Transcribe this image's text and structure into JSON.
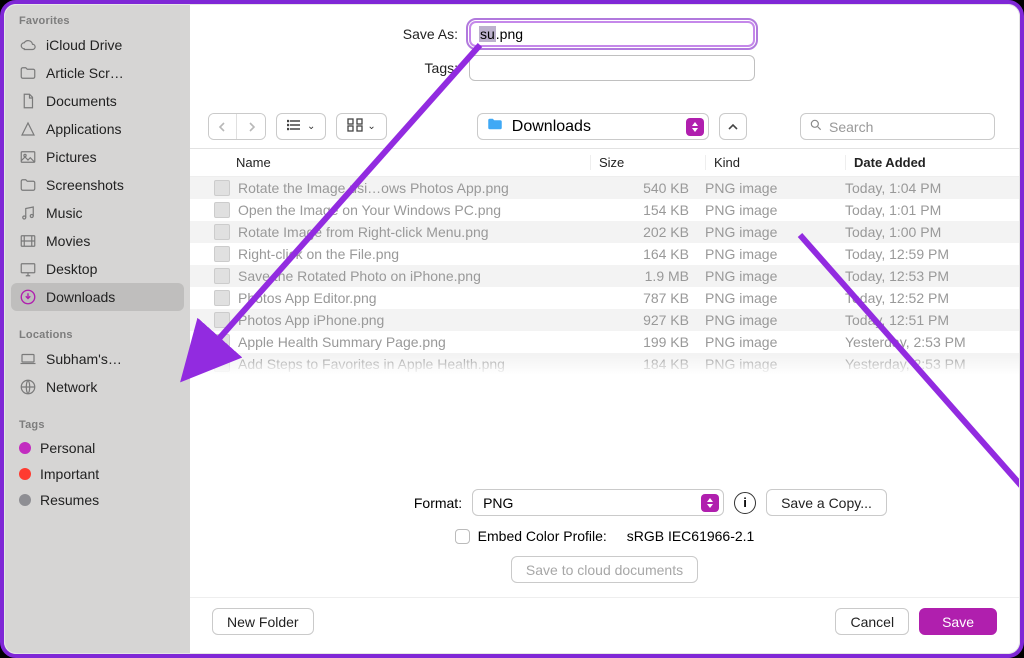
{
  "sidebar": {
    "favorites_header": "Favorites",
    "items": [
      {
        "label": "iCloud Drive"
      },
      {
        "label": "Article Scr…"
      },
      {
        "label": "Documents"
      },
      {
        "label": "Applications"
      },
      {
        "label": "Pictures"
      },
      {
        "label": "Screenshots"
      },
      {
        "label": "Music"
      },
      {
        "label": "Movies"
      },
      {
        "label": "Desktop"
      },
      {
        "label": "Downloads"
      }
    ],
    "locations_header": "Locations",
    "locations": [
      {
        "label": "Subham's…"
      },
      {
        "label": "Network"
      }
    ],
    "tags_header": "Tags",
    "tags": [
      {
        "label": "Personal",
        "color": "#c22cc0"
      },
      {
        "label": "Important",
        "color": "#ff3b30"
      },
      {
        "label": "Resumes",
        "color": "#8e8e93"
      }
    ]
  },
  "fields": {
    "saveas_label": "Save As:",
    "filename_selected": "su",
    "filename_rest": ".png",
    "tags_label": "Tags:"
  },
  "toolbar": {
    "location": "Downloads",
    "search_placeholder": "Search"
  },
  "columns": {
    "name": "Name",
    "size": "Size",
    "kind": "Kind",
    "date": "Date Added"
  },
  "rows": [
    {
      "name": "Rotate the Image usi…ows Photos App.png",
      "size": "540 KB",
      "kind": "PNG image",
      "date": "Today, 1:04 PM"
    },
    {
      "name": "Open the Image on Your Windows PC.png",
      "size": "154 KB",
      "kind": "PNG image",
      "date": "Today, 1:01 PM"
    },
    {
      "name": "Rotate Image from Right-click Menu.png",
      "size": "202 KB",
      "kind": "PNG image",
      "date": "Today, 1:00 PM"
    },
    {
      "name": "Right-click on the File.png",
      "size": "164 KB",
      "kind": "PNG image",
      "date": "Today, 12:59 PM"
    },
    {
      "name": "Save the Rotated Photo on iPhone.png",
      "size": "1.9 MB",
      "kind": "PNG image",
      "date": "Today, 12:53 PM"
    },
    {
      "name": "Photos App Editor.png",
      "size": "787 KB",
      "kind": "PNG image",
      "date": "Today, 12:52 PM"
    },
    {
      "name": "Photos App iPhone.png",
      "size": "927 KB",
      "kind": "PNG image",
      "date": "Today, 12:51 PM"
    },
    {
      "name": "Apple Health Summary Page.png",
      "size": "199 KB",
      "kind": "PNG image",
      "date": "Yesterday, 2:53 PM"
    },
    {
      "name": "Add Steps to Favorites in Apple Health.png",
      "size": "184 KB",
      "kind": "PNG image",
      "date": "Yesterday, 2:53 PM"
    }
  ],
  "format_row": {
    "label": "Format:",
    "value": "PNG",
    "save_copy": "Save a Copy..."
  },
  "embed": {
    "label": "Embed Color Profile:",
    "profile": "sRGB IEC61966-2.1"
  },
  "cloud_button": "Save to cloud documents",
  "bottom": {
    "new_folder": "New Folder",
    "cancel": "Cancel",
    "save": "Save"
  }
}
